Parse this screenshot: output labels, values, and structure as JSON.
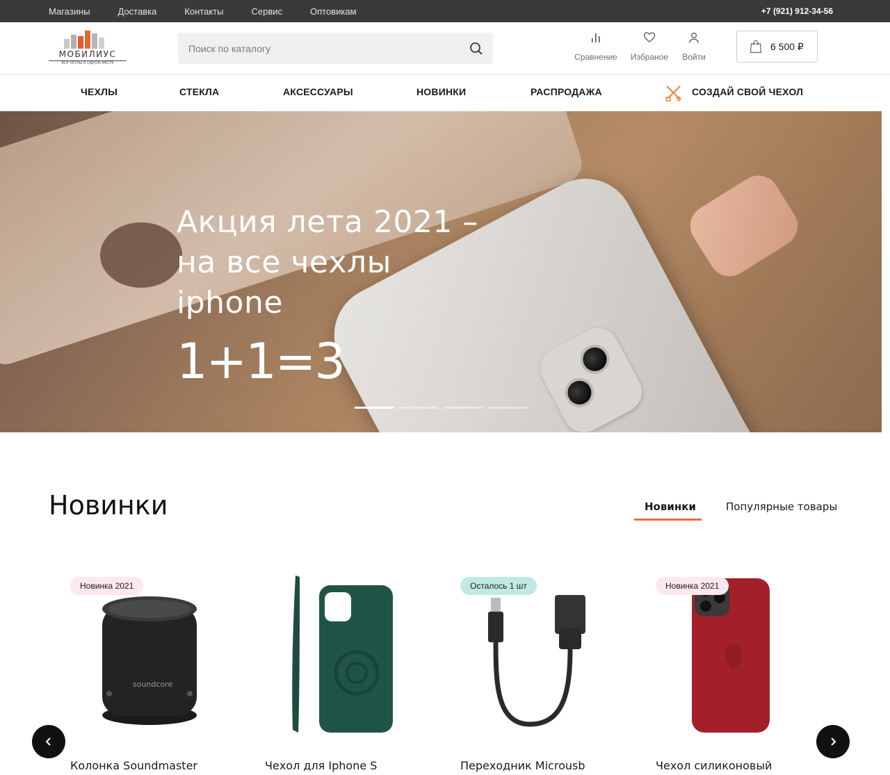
{
  "topbar": {
    "links": [
      "Магазины",
      "Доставка",
      "Контакты",
      "Сервис",
      "Оптовикам"
    ],
    "phone": "+7 (921) 912-34-56"
  },
  "header": {
    "logo_text": "МОБИЛИУС",
    "logo_tagline": "ВСЕ ЧЕХЛЫ В ОДНОМ МЕСТЕ",
    "search_placeholder": "Поиск по каталогу",
    "compare_label": "Сравнение",
    "favorites_label": "Избраное",
    "login_label": "Войти",
    "cart_total": "6 500 ₽"
  },
  "nav": {
    "items": [
      "ЧЕХЛЫ",
      "СТЕКЛА",
      "АКСЕССУАРЫ",
      "НОВИНКИ",
      "РАСПРОДАЖА"
    ],
    "custom_case": "СОЗДАЙ СВОЙ ЧЕХОЛ"
  },
  "hero": {
    "title": "Акция лета 2021 – на все чехлы iphone",
    "promo": "1+1=3",
    "slides_count": 4,
    "active_slide": 1
  },
  "section": {
    "title": "Новинки",
    "tabs": [
      "Новинки",
      "Популярные товары"
    ],
    "active_tab": 0
  },
  "products": [
    {
      "name": "Колонка Soundmaster",
      "badge": "Новинка 2021",
      "badge_type": "new"
    },
    {
      "name": "Чехол для Iphone S",
      "badge": "",
      "badge_type": ""
    },
    {
      "name": "Переходник Microusb",
      "badge": "Осталось 1 шт",
      "badge_type": "last"
    },
    {
      "name": "Чехол силиконовый",
      "badge": "Новинка 2021",
      "badge_type": "new"
    }
  ],
  "colors": {
    "topbar_bg": "#3a3a3a",
    "accent": "#e86c37",
    "badge_new": "#fbe8f0",
    "badge_last": "#bfeae3"
  }
}
